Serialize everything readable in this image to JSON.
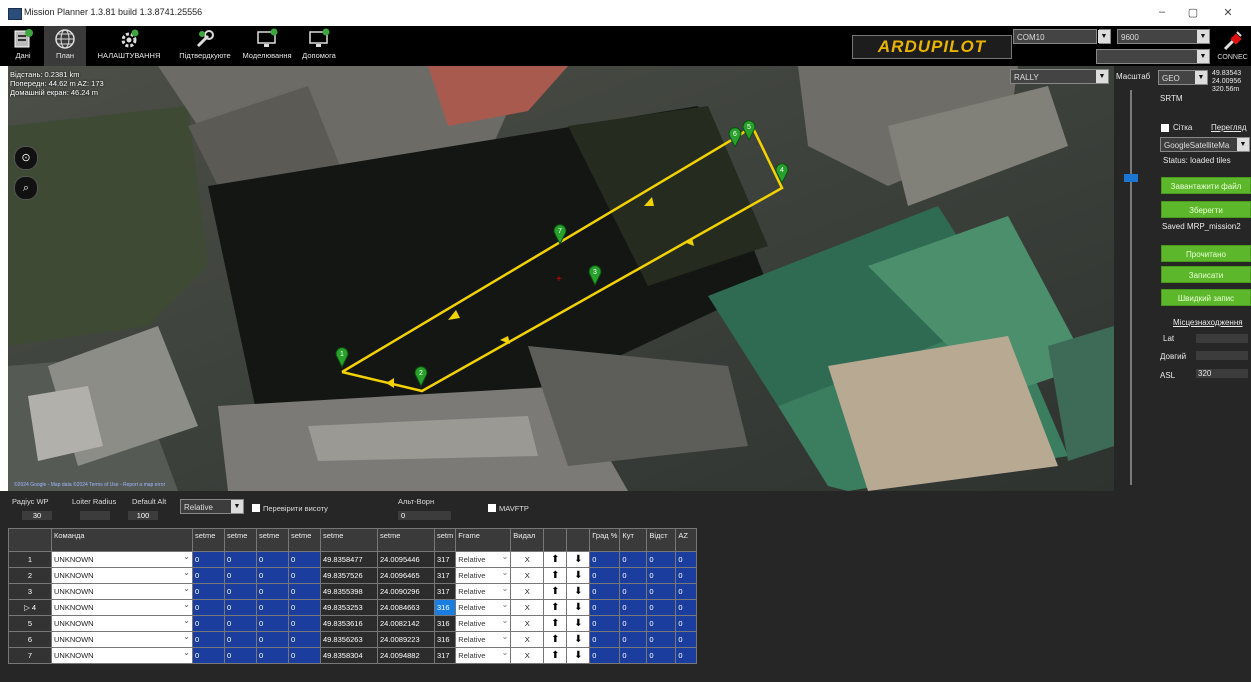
{
  "window": {
    "title": "Mission Planner 1.3.81 build 1.3.8741.25556",
    "minimize": "–",
    "maximize": "▢",
    "close": "✕"
  },
  "toolbar": {
    "items": [
      {
        "label": "Дані"
      },
      {
        "label": "План"
      },
      {
        "label": "НАЛАШТУВАННЯ"
      },
      {
        "label": "Підтвердкуюте"
      },
      {
        "label": "Моделювання"
      },
      {
        "label": "Допомога"
      }
    ],
    "logo": "ARDUPILOT",
    "port": "COM10",
    "baud": "9600",
    "connect": "CONNEC"
  },
  "map": {
    "info": {
      "distance": "Відстань: 0.2381 km",
      "prev": "Попередн: 44.62 m AZ: 173",
      "home": "Домашній екран: 46.24 m"
    },
    "layer_select": "RALLY",
    "attribution": "©2024 Google - Map data ©2024 Terms of Use - Report a map error",
    "waypoints": [
      "1",
      "2",
      "3",
      "4",
      "5",
      "6",
      "7"
    ]
  },
  "right_panel": {
    "scale_label": "Масштаб",
    "coord_type": "GEO",
    "lat": "49.83543",
    "lon": "24.00956",
    "alt": "320.56m",
    "srtm": "SRTM",
    "grid_label": "Сітка",
    "overlay_link": "Перегляд",
    "map_source": "GoogleSatelliteMa",
    "status": "Status: loaded tiles",
    "buttons": {
      "load_file": "Завантажити файл",
      "save": "Зберегти",
      "read": "Прочитано",
      "write": "Записати",
      "fast_write": "Швидкий запис"
    },
    "saved_file": "Saved MRP_mission2",
    "location_heading": "Місцезнаходження",
    "lat_label": "Lat",
    "lon_label": "Довгий",
    "asl_label": "ASL",
    "asl_value": "320",
    "down_button": "v"
  },
  "bottom": {
    "wp_radius_label": "Радіус WP",
    "wp_radius": "30",
    "loiter_label": "Loiter Radius",
    "default_alt_label": "Default Alt",
    "default_alt": "100",
    "alt_frame": "Relative",
    "verify_height": "Перевірити висоту",
    "alt_warn_label": "Альт-Ворн",
    "alt_warn": "0",
    "mavftp": "MAVFTP"
  },
  "grid": {
    "headers": [
      "",
      "Команда",
      "setme",
      "setme",
      "setme",
      "setme",
      "setme",
      "setme",
      "setm",
      "Frame",
      "Видал",
      "",
      "",
      "Град %",
      "Кут",
      "Відст",
      "AZ"
    ],
    "rows": [
      {
        "n": "1",
        "cmd": "UNKNOWN",
        "p1": "0",
        "p2": "0",
        "p3": "0",
        "p4": "0",
        "lat": "49.8358477",
        "lon": "24.0095446",
        "alt": "317",
        "frame": "Relative",
        "del": "X",
        "grad": "0",
        "ang": "0",
        "dist": "0",
        "az": "0"
      },
      {
        "n": "2",
        "cmd": "UNKNOWN",
        "p1": "0",
        "p2": "0",
        "p3": "0",
        "p4": "0",
        "lat": "49.8357526",
        "lon": "24.0096465",
        "alt": "317",
        "frame": "Relative",
        "del": "X",
        "grad": "0",
        "ang": "0",
        "dist": "0",
        "az": "0"
      },
      {
        "n": "3",
        "cmd": "UNKNOWN",
        "p1": "0",
        "p2": "0",
        "p3": "0",
        "p4": "0",
        "lat": "49.8355398",
        "lon": "24.0090296",
        "alt": "317",
        "frame": "Relative",
        "del": "X",
        "grad": "0",
        "ang": "0",
        "dist": "0",
        "az": "0"
      },
      {
        "n": "4",
        "cmd": "UNKNOWN",
        "p1": "0",
        "p2": "0",
        "p3": "0",
        "p4": "0",
        "lat": "49.8353253",
        "lon": "24.0084663",
        "alt": "316",
        "frame": "Relative",
        "del": "X",
        "grad": "0",
        "ang": "0",
        "dist": "0",
        "az": "0"
      },
      {
        "n": "5",
        "cmd": "UNKNOWN",
        "p1": "0",
        "p2": "0",
        "p3": "0",
        "p4": "0",
        "lat": "49.8353616",
        "lon": "24.0082142",
        "alt": "316",
        "frame": "Relative",
        "del": "X",
        "grad": "0",
        "ang": "0",
        "dist": "0",
        "az": "0"
      },
      {
        "n": "6",
        "cmd": "UNKNOWN",
        "p1": "0",
        "p2": "0",
        "p3": "0",
        "p4": "0",
        "lat": "49.8356263",
        "lon": "24.0089223",
        "alt": "316",
        "frame": "Relative",
        "del": "X",
        "grad": "0",
        "ang": "0",
        "dist": "0",
        "az": "0"
      },
      {
        "n": "7",
        "cmd": "UNKNOWN",
        "p1": "0",
        "p2": "0",
        "p3": "0",
        "p4": "0",
        "lat": "49.8358304",
        "lon": "24.0094882",
        "alt": "317",
        "frame": "Relative",
        "del": "X",
        "grad": "0",
        "ang": "0",
        "dist": "0",
        "az": "0"
      }
    ]
  },
  "colors": {
    "path": "#f2d300",
    "waypoint": "#27a12b",
    "green_button": "#5cb82a",
    "selected_cell": "#1a7de0"
  }
}
